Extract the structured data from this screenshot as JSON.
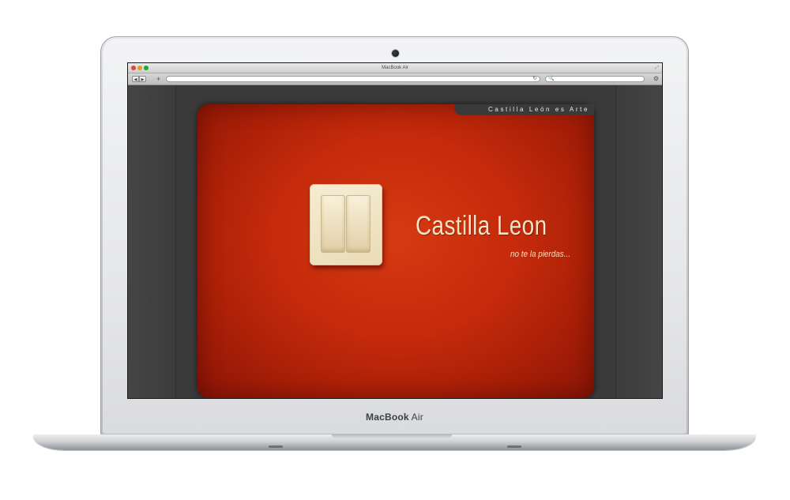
{
  "device": {
    "brand": "MacBook",
    "model": "Air"
  },
  "browser": {
    "window_title": "MacBook Air",
    "url": "",
    "search_placeholder": ""
  },
  "page": {
    "tab_label": "Castilla León es Arte",
    "headline": "Castilla Leon",
    "tagline": "no te la pierdas..."
  },
  "colors": {
    "accent_red": "#c42a0b",
    "text_cream": "#f1e3c3",
    "frame_dark": "#3a3a3a"
  }
}
